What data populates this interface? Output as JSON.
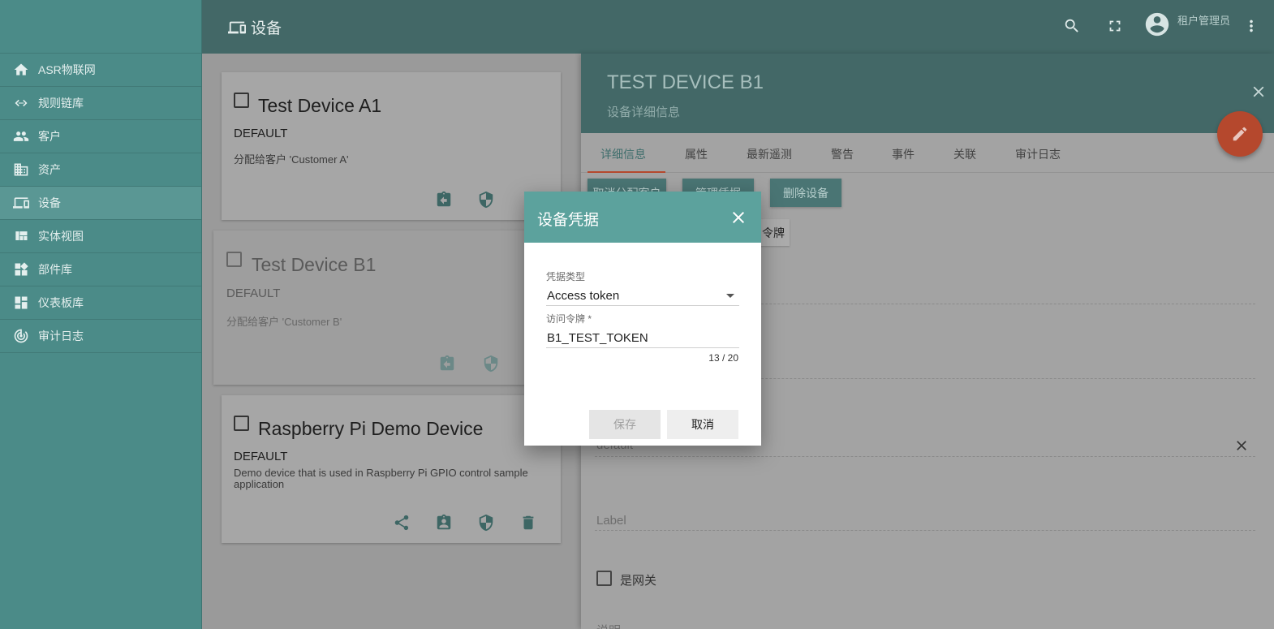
{
  "sidebar": {
    "items": [
      {
        "label": "ASR物联网",
        "icon": "home-icon"
      },
      {
        "label": "规则链库",
        "icon": "code-icon"
      },
      {
        "label": "客户",
        "icon": "people-icon"
      },
      {
        "label": "资产",
        "icon": "domain-icon"
      },
      {
        "label": "设备",
        "icon": "devices-icon"
      },
      {
        "label": "实体视图",
        "icon": "view-quilt-icon"
      },
      {
        "label": "部件库",
        "icon": "widgets-icon"
      },
      {
        "label": "仪表板库",
        "icon": "dashboard-icon"
      },
      {
        "label": "审计日志",
        "icon": "track-changes-icon"
      }
    ]
  },
  "toolbar": {
    "title": "设备",
    "user_name": "租户管理员"
  },
  "cards": [
    {
      "title": "Test Device A1",
      "type": "DEFAULT",
      "desc": "分配给客户 'Customer A'"
    },
    {
      "title": "Test Device B1",
      "type": "DEFAULT",
      "desc": "分配给客户 'Customer B'"
    },
    {
      "title": "Raspberry Pi Demo Device",
      "type": "DEFAULT",
      "desc": "Demo device that is used in Raspberry Pi GPIO control sample application"
    }
  ],
  "panel": {
    "title": "TEST DEVICE B1",
    "subtitle": "设备详细信息",
    "tabs": [
      "详细信息",
      "属性",
      "最新遥测",
      "警告",
      "事件",
      "关联",
      "审计日志"
    ],
    "buttons": {
      "unassign": "取消分配客户",
      "manage_credentials": "管理凭据",
      "delete": "删除设备",
      "copy_token": "令牌"
    },
    "fields": {
      "type_value": "default",
      "label_placeholder": "Label",
      "gateway_label": "是网关",
      "description_label": "说明"
    }
  },
  "dialog": {
    "title": "设备凭据",
    "type_label": "凭据类型",
    "type_value": "Access token",
    "token_label": "访问令牌 *",
    "token_value": "B1_TEST_TOKEN",
    "counter": "13 / 20",
    "save_label": "保存",
    "cancel_label": "取消"
  },
  "colors": {
    "accent": "#5ca29d",
    "toolbar": "#436867",
    "fab": "#b5482d"
  }
}
